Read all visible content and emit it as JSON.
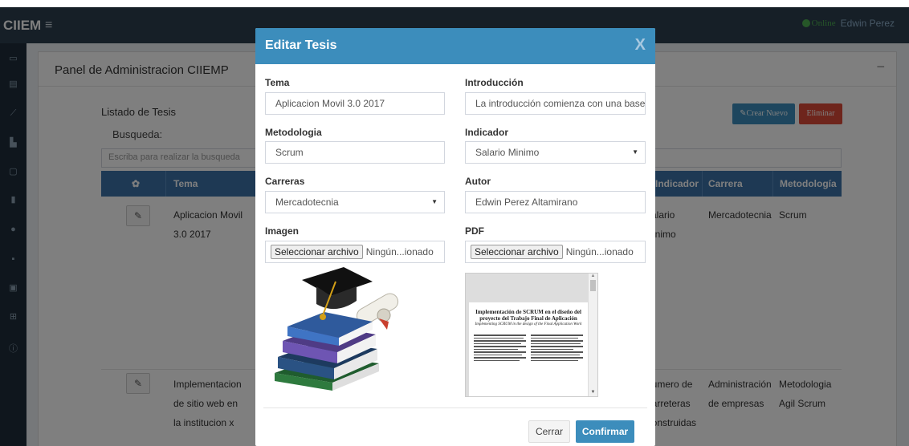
{
  "app": {
    "brand": "CIIEM",
    "status": "Online",
    "user": "Edwin Perez"
  },
  "panel": {
    "title": "Panel de Administracion CIIEMP",
    "list_title": "Listado de Tesis",
    "search_label": "Busqueda:",
    "search_placeholder": "Escriba para realizar la busqueda",
    "new_button": "Crear Nuevo",
    "delete_button": "Eliminar"
  },
  "table": {
    "headers": {
      "tema": "Tema",
      "indicador": "Indicador",
      "carrera": "Carrera",
      "metodologia": "Metodología"
    },
    "rows": [
      {
        "tema": [
          "Aplicacion Movil",
          "3.0 2017"
        ],
        "indicador": [
          "Salario",
          "Minimo"
        ],
        "carrera": [
          "Mercadotecnia"
        ],
        "metodologia": [
          "Scrum"
        ]
      },
      {
        "tema": [
          "Implementacion",
          "de sitio web en",
          "la institucion x"
        ],
        "indicador": [
          "Numero de",
          "Carreteras",
          "Construidas"
        ],
        "carrera": [
          "Administración",
          "de empresas"
        ],
        "metodologia": [
          "Metodologia",
          "Agil Scrum"
        ]
      }
    ]
  },
  "modal": {
    "title": "Editar Tesis",
    "close": "X",
    "fields": {
      "tema": {
        "label": "Tema",
        "value": "Aplicacion Movil 3.0 2017"
      },
      "introduccion": {
        "label": "Introducción",
        "value": "La introducción comienza con una base"
      },
      "metodologia": {
        "label": "Metodologia",
        "value": "Scrum"
      },
      "indicador": {
        "label": "Indicador",
        "value": "Salario Minimo"
      },
      "carreras": {
        "label": "Carreras",
        "value": "Mercadotecnia"
      },
      "autor": {
        "label": "Autor",
        "value": "Edwin Perez Altamirano"
      },
      "imagen": {
        "label": "Imagen",
        "button": "Seleccionar archivo",
        "file_text": "Ningún...ionado"
      },
      "pdf": {
        "label": "PDF",
        "button": "Seleccionar archivo",
        "file_text": "Ningún...ionado"
      }
    },
    "pdf_preview": {
      "title": "Implementación de SCRUM en el diseño del proyecto del Trabajo Final de Aplicación",
      "subtitle": "Implementing SCRUM in the design of the Final Application Work"
    },
    "cancel_button": "Cerrar",
    "confirm_button": "Confirmar"
  }
}
